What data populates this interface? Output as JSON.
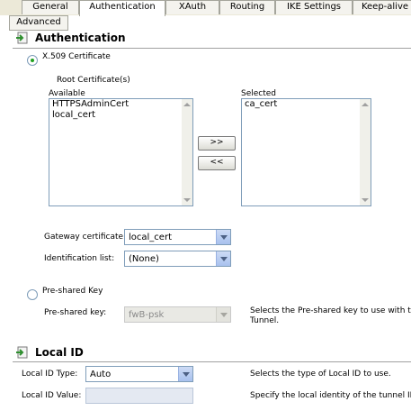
{
  "tabs": [
    {
      "label": "General"
    },
    {
      "label": "Authentication"
    },
    {
      "label": "XAuth"
    },
    {
      "label": "Routing"
    },
    {
      "label": "IKE Settings"
    },
    {
      "label": "Keep-alive"
    },
    {
      "label": "Advanced"
    }
  ],
  "active_tab": "Authentication",
  "authentication": {
    "title": "Authentication",
    "x509_label": "X.509 Certificate",
    "x509_selected": true,
    "root_cert_label": "Root Certificate(s)",
    "available_label": "Available",
    "available_items": [
      "HTTPSAdminCert",
      "local_cert"
    ],
    "selected_label": "Selected",
    "selected_items": [
      "ca_cert"
    ],
    "add_label": ">>",
    "remove_label": "<<",
    "gateway_cert_label": "Gateway certificate:",
    "gateway_cert_value": "local_cert",
    "ident_list_label": "Identification list:",
    "ident_list_value": "(None)",
    "psk_radio_label": "Pre-shared Key",
    "psk_label": "Pre-shared key:",
    "psk_value": "fwB-psk",
    "psk_desc_line1": "Selects the Pre-shared key to use with this",
    "psk_desc_line2": "Tunnel."
  },
  "local_id": {
    "title": "Local ID",
    "type_label": "Local ID Type:",
    "type_value": "Auto",
    "type_desc": "Selects the type of Local ID to use.",
    "value_label": "Local ID Value:",
    "value_value": "",
    "value_desc": "Specify the local identity of the tunnel ID."
  },
  "colors": {
    "tab_bg": "#ece9d8",
    "accent_radio": "#21a121",
    "select_caret": "#a8c1ee"
  }
}
